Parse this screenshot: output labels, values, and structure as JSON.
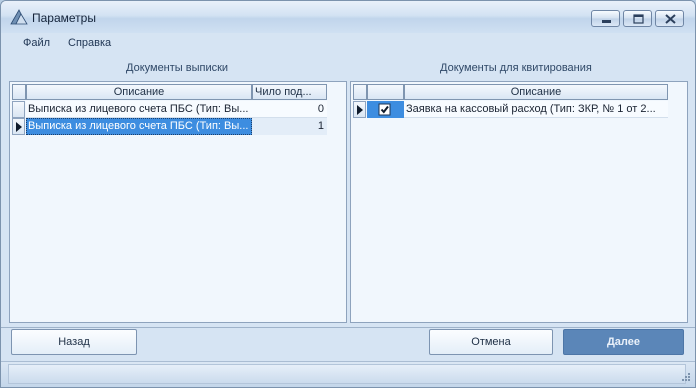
{
  "window": {
    "title": "Параметры"
  },
  "menu": {
    "file": "Файл",
    "help": "Справка"
  },
  "left_panel": {
    "title": "Документы выписки",
    "columns": [
      "Описание",
      "Чило под..."
    ],
    "rows": [
      {
        "description": "Выписка из лицевого счета ПБС (Тип: Вы...",
        "count": "0",
        "current": false
      },
      {
        "description": "Выписка из лицевого счета ПБС (Тип: Вы...",
        "count": "1",
        "current": true
      }
    ]
  },
  "right_panel": {
    "title": "Документы для квитирования",
    "columns": [
      "Описание"
    ],
    "rows": [
      {
        "checked": true,
        "description": "Заявка на кассовый расход (Тип: ЗКР, № 1 от 2...",
        "current": true
      }
    ]
  },
  "buttons": {
    "back": "Назад",
    "cancel": "Отмена",
    "next": "Далее"
  },
  "colors": {
    "accent": "#5b86b8",
    "selection": "#3d8de0",
    "window_bg": "#d6e4f3"
  },
  "icons": [
    "app-icon",
    "minimize-icon",
    "maximize-icon",
    "close-icon",
    "row-pointer-icon",
    "checkbox-check-icon",
    "size-grip-icon"
  ]
}
